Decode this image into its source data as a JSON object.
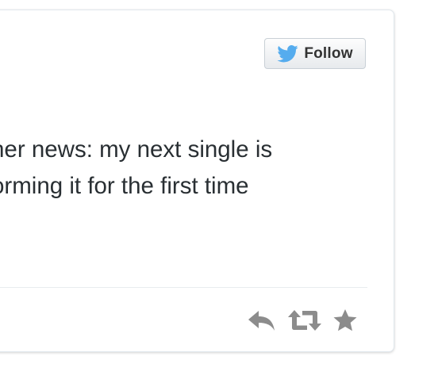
{
  "tweet": {
    "follow_label": "Follow",
    "text_lines": [
      "her news: my next single is",
      "orming it for the first time"
    ]
  },
  "icons": {
    "follow": "twitter-bird-icon",
    "reply": "reply-icon",
    "retweet": "retweet-icon",
    "favorite": "star-icon"
  },
  "colors": {
    "twitter_blue": "#55acee",
    "text": "#292f33",
    "action_gray": "#8c8c8c"
  }
}
